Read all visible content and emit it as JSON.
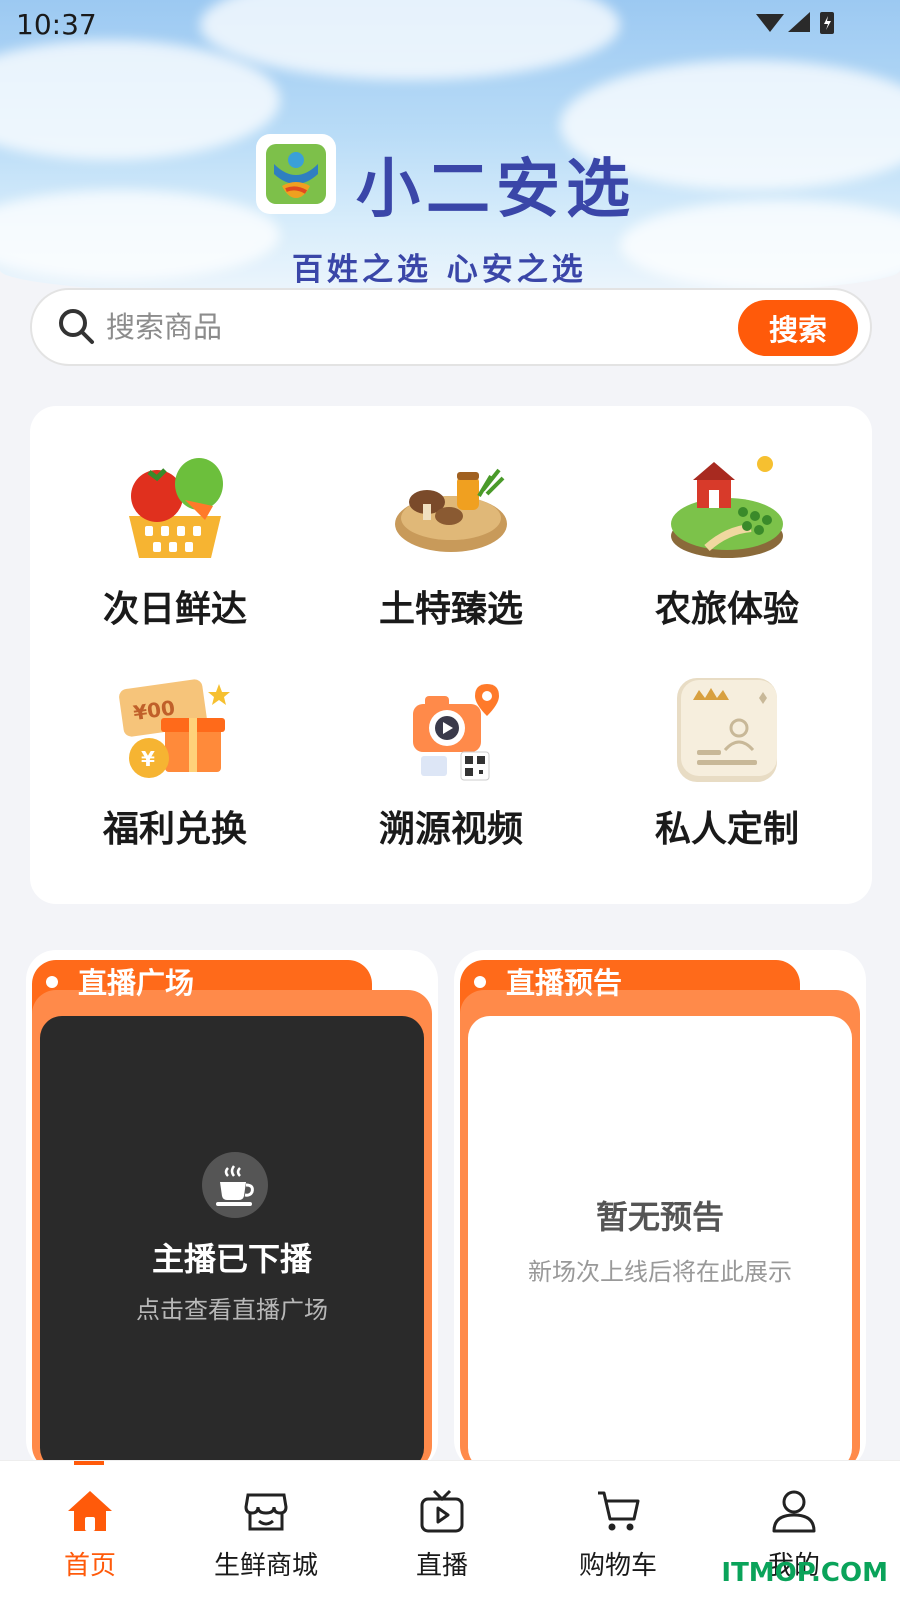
{
  "status_bar": {
    "time": "10:37"
  },
  "header": {
    "app_title": "小二安选",
    "slogan": "百姓之选  心安之选",
    "logo_icon": "xiaoer-logo-icon"
  },
  "search": {
    "placeholder": "搜索商品",
    "button_label": "搜索"
  },
  "categories": [
    {
      "label": "次日鲜达",
      "icon": "vegetable-basket-icon"
    },
    {
      "label": "土特臻选",
      "icon": "mushroom-basket-icon"
    },
    {
      "label": "农旅体验",
      "icon": "farm-island-icon"
    },
    {
      "label": "福利兑换",
      "icon": "coupon-gift-icon"
    },
    {
      "label": "溯源视频",
      "icon": "camera-qrcode-icon"
    },
    {
      "label": "私人定制",
      "icon": "custom-card-icon"
    }
  ],
  "live_square": {
    "title": "直播广场",
    "status_title": "主播已下播",
    "status_subtitle": "点击查看直播广场"
  },
  "live_preview": {
    "title": "直播预告",
    "empty_title": "暂无预告",
    "empty_subtitle": "新场次上线后将在此展示"
  },
  "tabbar": {
    "active_color": "#ff5a0a",
    "tabs": [
      {
        "label": "首页",
        "icon": "home-icon",
        "active": true
      },
      {
        "label": "生鲜商城",
        "icon": "store-icon",
        "active": false
      },
      {
        "label": "直播",
        "icon": "tv-play-icon",
        "active": false
      },
      {
        "label": "购物车",
        "icon": "cart-icon",
        "active": false
      },
      {
        "label": "我的",
        "icon": "user-icon",
        "active": false
      }
    ]
  },
  "watermark": "ITMOP.COM"
}
